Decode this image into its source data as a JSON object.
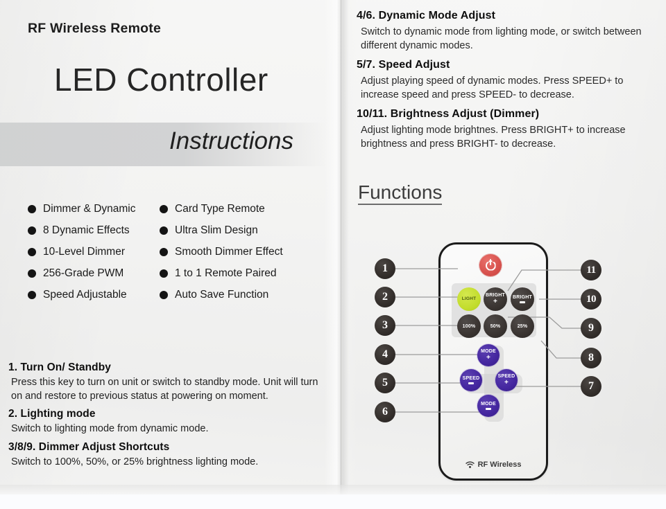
{
  "document": {
    "kicker": "RF Wireless Remote",
    "title": "LED Controller",
    "subtitle": "Instructions"
  },
  "features": {
    "column_left": [
      "Dimmer & Dynamic",
      "8 Dynamic Effects",
      "10-Level Dimmer",
      "256-Grade PWM",
      "Speed Adjustable"
    ],
    "column_right": [
      "Card Type Remote",
      "Ultra Slim Design",
      "Smooth Dimmer Effect",
      "1 to 1 Remote Paired",
      "Auto Save Function"
    ]
  },
  "instructions_left": [
    {
      "heading": "1. Turn On/ Standby",
      "body": "Press this key to turn on unit or switch to standby mode. Unit will turn on and restore to previous status at powering on moment."
    },
    {
      "heading": "2. Lighting mode",
      "body": "Switch to lighting  mode from dynamic mode."
    },
    {
      "heading": "3/8/9. Dimmer Adjust Shortcuts",
      "body": "Switch to 100%, 50%, or 25%  brightness lighting mode."
    }
  ],
  "instructions_right": [
    {
      "heading": "4/6. Dynamic Mode Adjust",
      "body": "Switch to dynamic mode from lighting mode, or switch between different dynamic modes."
    },
    {
      "heading": "5/7. Speed Adjust",
      "body": "Adjust playing speed of dynamic modes. Press SPEED+ to increase speed and press SPEED- to decrease."
    },
    {
      "heading": "10/11. Brightness Adjust (Dimmer)",
      "body": "Adjust lighting mode brightnes. Press BRIGHT+ to increase brightness and press BRIGHT- to decrease."
    }
  ],
  "functions": {
    "section_title": "Functions",
    "remote": {
      "footer_label": "RF Wireless",
      "buttons": {
        "power": {
          "label": "",
          "icon": "power-icon",
          "color": "#d9534f"
        },
        "light": {
          "label": "LIGHT",
          "color": "#c3dd2e"
        },
        "bright_plus": {
          "label": "BRIGHT",
          "sign": "+",
          "color": "#3a3431"
        },
        "bright_minus": {
          "label": "BRIGHT",
          "sign": "–",
          "color": "#3a3431"
        },
        "preset_100": {
          "label": "100%",
          "color": "#3a3431"
        },
        "preset_50": {
          "label": "50%",
          "color": "#3a3431"
        },
        "preset_25": {
          "label": "25%",
          "color": "#3a3431"
        },
        "mode_plus": {
          "label": "MODE",
          "sign": "+",
          "color": "#4527a0"
        },
        "mode_minus": {
          "label": "MODE",
          "sign": "–",
          "color": "#4527a0"
        },
        "speed_plus": {
          "label": "SPEED",
          "sign": "+",
          "color": "#4527a0"
        },
        "speed_minus": {
          "label": "SPEED",
          "sign": "–",
          "color": "#4527a0"
        }
      }
    },
    "callouts_left": [
      "1",
      "2",
      "3",
      "4",
      "5",
      "6"
    ],
    "callouts_right": [
      "11",
      "10",
      "9",
      "8",
      "7"
    ]
  },
  "colors": {
    "paper": "#f2f2f1",
    "band": "#cfd0d1",
    "ink": "#1a1a1a",
    "power_red": "#d9534f",
    "light_green": "#c3dd2e",
    "key_dark": "#3a3431",
    "key_purple": "#4527a0"
  }
}
